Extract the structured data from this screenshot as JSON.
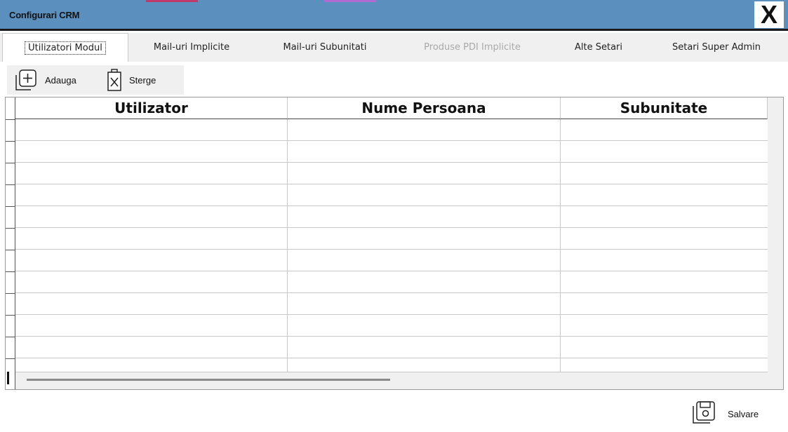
{
  "window": {
    "title": "Configurari CRM",
    "close_label": "X",
    "accent_color": "#5b8fbe"
  },
  "tabs": [
    {
      "label": "Utilizatori Modul",
      "active": true,
      "enabled": true
    },
    {
      "label": "Mail-uri Implicite",
      "active": false,
      "enabled": true
    },
    {
      "label": "Mail-uri Subunitati",
      "active": false,
      "enabled": true
    },
    {
      "label": "Produse PDI Implicite",
      "active": false,
      "enabled": false
    },
    {
      "label": "Alte Setari",
      "active": false,
      "enabled": true
    },
    {
      "label": "Setari Super Admin",
      "active": false,
      "enabled": true
    }
  ],
  "toolbar": {
    "add_label": "Adauga",
    "add_icon": "add-icon",
    "delete_label": "Sterge",
    "delete_icon": "delete-icon"
  },
  "grid": {
    "columns": [
      "Utilizator",
      "Nume Persoana",
      "Subunitate"
    ],
    "rows": [
      [
        "",
        "",
        ""
      ],
      [
        "",
        "",
        ""
      ],
      [
        "",
        "",
        ""
      ],
      [
        "",
        "",
        ""
      ],
      [
        "",
        "",
        ""
      ],
      [
        "",
        "",
        ""
      ],
      [
        "",
        "",
        ""
      ],
      [
        "",
        "",
        ""
      ],
      [
        "",
        "",
        ""
      ],
      [
        "",
        "",
        ""
      ],
      [
        "",
        "",
        ""
      ],
      [
        "",
        "",
        ""
      ]
    ]
  },
  "footer": {
    "save_label": "Salvare",
    "save_icon": "save-icon"
  }
}
